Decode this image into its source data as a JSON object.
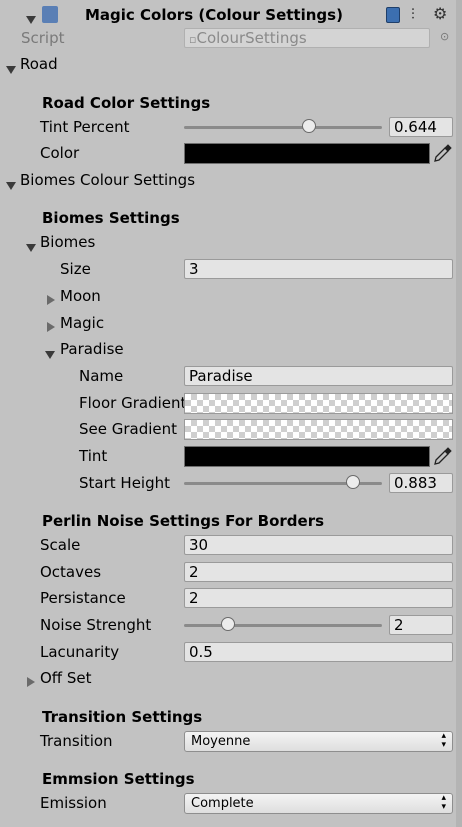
{
  "header": {
    "title": "Magic Colors (Colour Settings)",
    "script_label": "Script",
    "script_value": "ColourSettings"
  },
  "road": {
    "foldout": "Road",
    "section": "Road Color Settings",
    "tint_label": "Tint Percent",
    "tint_value": "0.644",
    "tint_fraction": 0.644,
    "color_label": "Color",
    "color_value": "#000000"
  },
  "biomes_colour": {
    "foldout": "Biomes Colour Settings",
    "section": "Biomes Settings",
    "biomes_foldout": "Biomes",
    "size_label": "Size",
    "size_value": "3",
    "items": [
      "Moon",
      "Magic",
      "Paradise"
    ],
    "paradise": {
      "name_label": "Name",
      "name_value": "Paradise",
      "floor_label": "Floor Gradient",
      "see_label": "See Gradient",
      "tint_label": "Tint",
      "tint_color": "#000000",
      "height_label": "Start Height",
      "height_value": "0.883",
      "height_fraction": 0.883
    }
  },
  "perlin": {
    "section": "Perlin Noise Settings For Borders",
    "scale_label": "Scale",
    "scale_value": "30",
    "octaves_label": "Octaves",
    "octaves_value": "2",
    "persistance_label": "Persistance",
    "persistance_value": "2",
    "noise_label": "Noise Strenght",
    "noise_value": "2",
    "noise_fraction": 0.2,
    "lacunarity_label": "Lacunarity",
    "lacunarity_value": "0.5",
    "offset_foldout": "Off Set"
  },
  "transition": {
    "section": "Transition Settings",
    "label": "Transition",
    "value": "Moyenne"
  },
  "emission": {
    "section": "Emmsion Settings",
    "label": "Emission",
    "value": "Complete"
  },
  "colors": {
    "background": "#c2c2c2",
    "field": "#e4e4e4",
    "swatch": "#000000"
  }
}
